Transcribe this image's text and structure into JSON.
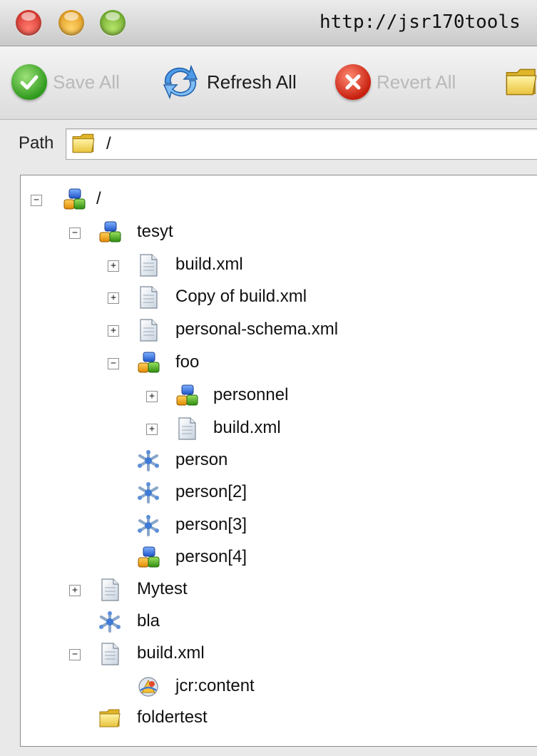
{
  "window": {
    "title": "http://jsr170tools"
  },
  "toolbar": {
    "save_all": {
      "label": "Save All",
      "enabled": false,
      "icon": "check-icon"
    },
    "refresh_all": {
      "label": "Refresh All",
      "enabled": true,
      "icon": "refresh-icon"
    },
    "revert_all": {
      "label": "Revert All",
      "enabled": false,
      "icon": "cancel-x-icon"
    },
    "folder": {
      "icon": "folder-icon"
    }
  },
  "path": {
    "label": "Path",
    "value": "/"
  },
  "tree": {
    "root": {
      "label": "/",
      "icon": "node-icon",
      "expanded": true
    },
    "tesyt": {
      "label": "tesyt",
      "icon": "node-icon",
      "expanded": true
    },
    "tesyt_build": {
      "label": "build.xml",
      "icon": "file-icon",
      "expanded": false
    },
    "tesyt_copy": {
      "label": "Copy of build.xml",
      "icon": "file-icon",
      "expanded": false
    },
    "tesyt_schema": {
      "label": "personal-schema.xml",
      "icon": "file-icon",
      "expanded": false
    },
    "foo": {
      "label": "foo",
      "icon": "node-icon",
      "expanded": true
    },
    "personnel": {
      "label": "personnel",
      "icon": "node-icon",
      "expanded": false
    },
    "foo_build": {
      "label": "build.xml",
      "icon": "file-icon",
      "expanded": false
    },
    "person": {
      "label": "person",
      "icon": "unstructured-icon"
    },
    "person2": {
      "label": "person[2]",
      "icon": "unstructured-icon"
    },
    "person3": {
      "label": "person[3]",
      "icon": "unstructured-icon"
    },
    "person4": {
      "label": "person[4]",
      "icon": "node-icon"
    },
    "mytest": {
      "label": "Mytest",
      "icon": "file-icon",
      "expanded": false
    },
    "bla": {
      "label": "bla",
      "icon": "unstructured-icon"
    },
    "root_build": {
      "label": "build.xml",
      "icon": "file-icon",
      "expanded": true
    },
    "jcr_content": {
      "label": "jcr:content",
      "icon": "resource-icon"
    },
    "foldertest": {
      "label": "foldertest",
      "icon": "folder-icon"
    }
  }
}
